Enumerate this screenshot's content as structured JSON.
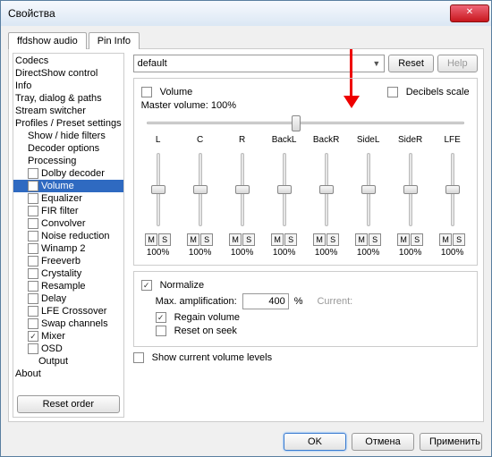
{
  "window": {
    "title": "Свойства"
  },
  "tabs": [
    "ffdshow audio",
    "Pin Info"
  ],
  "sidebar": {
    "reset_order": "Reset order",
    "items": [
      {
        "label": "Codecs",
        "indent": 0,
        "checkbox": false
      },
      {
        "label": "DirectShow control",
        "indent": 0,
        "checkbox": false
      },
      {
        "label": "Info",
        "indent": 0,
        "checkbox": false
      },
      {
        "label": "Tray, dialog & paths",
        "indent": 0,
        "checkbox": false
      },
      {
        "label": "Stream switcher",
        "indent": 0,
        "checkbox": false
      },
      {
        "label": "Profiles / Preset settings",
        "indent": 0,
        "checkbox": false
      },
      {
        "label": "Show / hide filters",
        "indent": 1,
        "checkbox": false
      },
      {
        "label": "Decoder options",
        "indent": 1,
        "checkbox": false
      },
      {
        "label": "Processing",
        "indent": 1,
        "checkbox": false
      },
      {
        "label": "Dolby decoder",
        "indent": 1,
        "checkbox": true,
        "checked": false
      },
      {
        "label": "Volume",
        "indent": 1,
        "checkbox": true,
        "checked": false,
        "selected": true
      },
      {
        "label": "Equalizer",
        "indent": 1,
        "checkbox": true,
        "checked": false
      },
      {
        "label": "FIR filter",
        "indent": 1,
        "checkbox": true,
        "checked": false
      },
      {
        "label": "Convolver",
        "indent": 1,
        "checkbox": true,
        "checked": false
      },
      {
        "label": "Noise reduction",
        "indent": 1,
        "checkbox": true,
        "checked": false
      },
      {
        "label": "Winamp 2",
        "indent": 1,
        "checkbox": true,
        "checked": false
      },
      {
        "label": "Freeverb",
        "indent": 1,
        "checkbox": true,
        "checked": false
      },
      {
        "label": "Crystality",
        "indent": 1,
        "checkbox": true,
        "checked": false
      },
      {
        "label": "Resample",
        "indent": 1,
        "checkbox": true,
        "checked": false
      },
      {
        "label": "Delay",
        "indent": 1,
        "checkbox": true,
        "checked": false
      },
      {
        "label": "LFE Crossover",
        "indent": 1,
        "checkbox": true,
        "checked": false
      },
      {
        "label": "Swap channels",
        "indent": 1,
        "checkbox": true,
        "checked": false
      },
      {
        "label": "Mixer",
        "indent": 1,
        "checkbox": true,
        "checked": true
      },
      {
        "label": "OSD",
        "indent": 1,
        "checkbox": true,
        "checked": false
      },
      {
        "label": "Output",
        "indent": 2,
        "checkbox": false
      },
      {
        "label": "About",
        "indent": 0,
        "checkbox": false
      }
    ]
  },
  "main": {
    "preset": "default",
    "reset": "Reset",
    "help": "Help",
    "volume_label": "Volume",
    "decibels_label": "Decibels scale",
    "master_label": "Master volume:",
    "master_value": "100%",
    "channels": [
      {
        "name": "L",
        "pct": "100%"
      },
      {
        "name": "C",
        "pct": "100%"
      },
      {
        "name": "R",
        "pct": "100%"
      },
      {
        "name": "BackL",
        "pct": "100%"
      },
      {
        "name": "BackR",
        "pct": "100%"
      },
      {
        "name": "SideL",
        "pct": "100%"
      },
      {
        "name": "SideR",
        "pct": "100%"
      },
      {
        "name": "LFE",
        "pct": "100%"
      }
    ],
    "m": "M",
    "s": "S",
    "normalize": "Normalize",
    "max_amp_label": "Max. amplification:",
    "max_amp_value": "400",
    "percent": "%",
    "current_label": "Current:",
    "regain": "Regain volume",
    "reset_seek": "Reset on seek",
    "show_levels": "Show current volume levels"
  },
  "footer": {
    "ok": "OK",
    "cancel": "Отмена",
    "apply": "Применить"
  }
}
